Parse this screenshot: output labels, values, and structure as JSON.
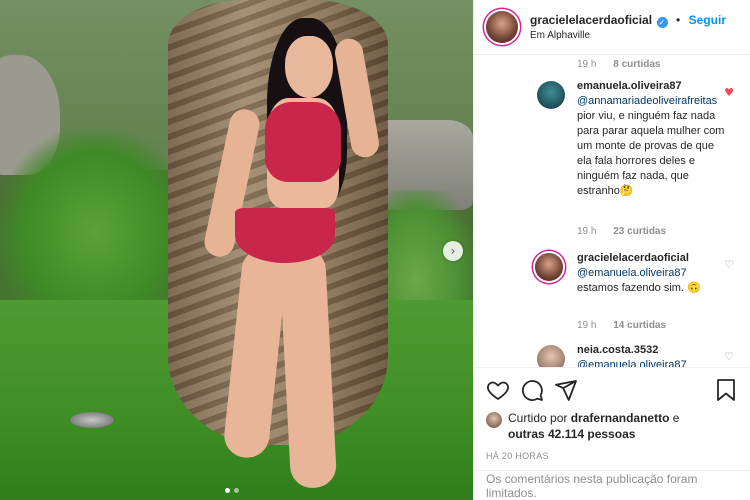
{
  "post_header": {
    "username": "gracielelacerdaoficial",
    "verified_glyph": "✓",
    "separator": "•",
    "follow_label": "Seguir",
    "location": "Em Alphaville"
  },
  "comments": [
    {
      "time": "19 h",
      "likes": "8 curtidas"
    },
    {
      "username": "emanuela.oliveira87",
      "mention": "@annamariadeoliveirafreitas",
      "text": " pior viu, e ninguém faz nada para parar aquela mulher com um monte de provas de que ela fala horrores deles e ninguém faz nada, que estranho🤔",
      "time": "19 h",
      "likes": "23 curtidas",
      "liked": true
    },
    {
      "username": "gracielelacerdaoficial",
      "mention": "@emanuela.oliveira87",
      "text": " estamos fazendo sim. 🙃",
      "time": "19 h",
      "likes": "14 curtidas",
      "liked": false
    },
    {
      "username": "neia.costa.3532",
      "mention": "@emanuela.oliveira87",
      "text": "",
      "liked": false
    }
  ],
  "actions": {
    "icons": [
      "heart-icon",
      "comment-icon",
      "share-icon",
      "bookmark-icon"
    ],
    "liked_by_prefix": "Curtido por",
    "liked_by_user": "drafernandanetto",
    "liked_by_suffix": "e",
    "liked_by_others": "outras 42.114 pessoas",
    "post_time": "HÁ 20 HORAS"
  },
  "comments_limited": "Os comentários nesta publicação foram limitados.",
  "carousel": {
    "slide_count": 2,
    "active_slide": 1,
    "next_glyph": "›"
  },
  "colors": {
    "link_blue": "#0095f6",
    "verified_blue": "#3897f0",
    "like_red": "#ed4956",
    "muted_text": "#8e8e8e",
    "mention": "#00376b"
  }
}
